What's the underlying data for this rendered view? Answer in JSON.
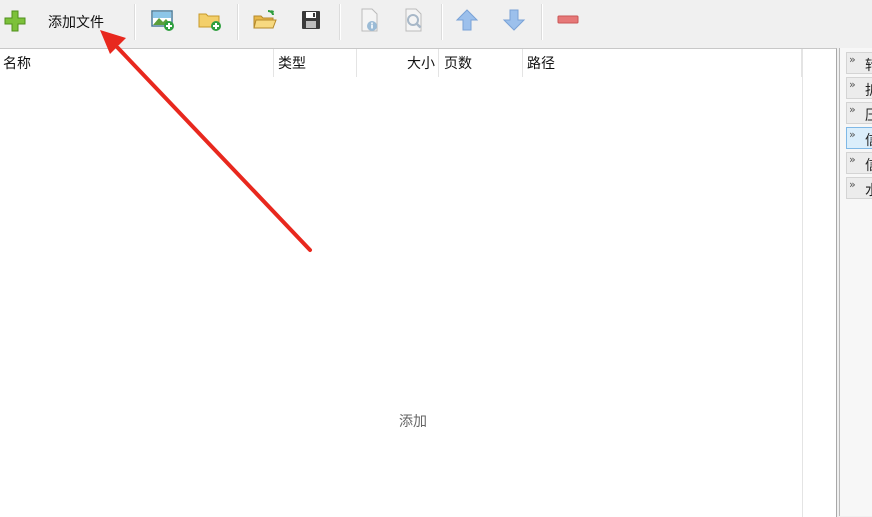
{
  "toolbar": {
    "add_file_label": "添加文件",
    "buttons": [
      {
        "icon": "plus-icon"
      },
      {
        "icon": "add-image-icon"
      },
      {
        "icon": "add-folder-icon"
      },
      {
        "icon": "open-folder-icon"
      },
      {
        "icon": "save-icon"
      },
      {
        "icon": "file-info-icon"
      },
      {
        "icon": "preview-icon"
      },
      {
        "icon": "move-up-icon"
      },
      {
        "icon": "move-down-icon"
      },
      {
        "icon": "remove-icon"
      }
    ]
  },
  "file_list": {
    "columns": {
      "name": "名称",
      "type": "类型",
      "size": "大小",
      "pages": "页数",
      "path": "路径"
    },
    "empty_hint": "添加"
  },
  "side_panel": {
    "items": [
      {
        "label": "转",
        "active": false
      },
      {
        "label": "拆",
        "active": false
      },
      {
        "label": "压",
        "active": false
      },
      {
        "label": "信",
        "active": true
      },
      {
        "label": "信",
        "active": false
      },
      {
        "label": "水",
        "active": false
      }
    ]
  },
  "colors": {
    "accent_green": "#6fb52c",
    "annotation_arrow": "#e8281e",
    "arrow_blue": "#8ab4e8",
    "remove_red": "#e46a6a"
  }
}
